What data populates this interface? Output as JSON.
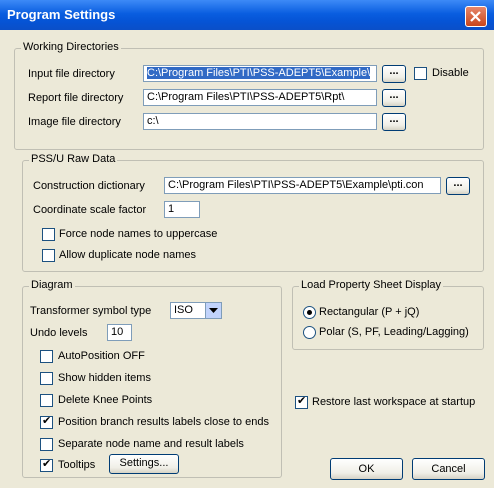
{
  "window": {
    "title": "Program Settings"
  },
  "working_directories": {
    "legend": "Working Directories",
    "input_label": "Input file directory",
    "input_value": "C:\\Program Files\\PTI\\PSS-ADEPT5\\Example\\",
    "report_label": "Report file directory",
    "report_value": "C:\\Program Files\\PTI\\PSS-ADEPT5\\Rpt\\",
    "image_label": "Image file directory",
    "image_value": "c:\\",
    "browse_label": "...",
    "disable_label": "Disable",
    "disable_checked": false
  },
  "pss_raw": {
    "legend": "PSS/U Raw Data",
    "construction_label": "Construction dictionary",
    "construction_value": "C:\\Program Files\\PTI\\PSS-ADEPT5\\Example\\pti.con",
    "scale_label": "Coordinate scale factor",
    "scale_value": "1",
    "force_upper_label": "Force node names to uppercase",
    "allow_dup_label": "Allow duplicate node names"
  },
  "diagram": {
    "legend": "Diagram",
    "transformer_label": "Transformer symbol type",
    "transformer_value": "ISO",
    "undo_label": "Undo levels",
    "undo_value": "10",
    "autoposition_label": "AutoPosition OFF",
    "show_hidden_label": "Show hidden items",
    "delete_knee_label": "Delete Knee Points",
    "position_branch_label": "Position branch results labels close to ends",
    "separate_label": "Separate node name and result labels",
    "tooltips_label": "Tooltips",
    "settings_label": "Settings..."
  },
  "load_property": {
    "legend": "Load Property Sheet Display",
    "rect_label": "Rectangular (P + jQ)",
    "polar_label": "Polar (S, PF, Leading/Lagging)",
    "selected": "rectangular"
  },
  "restore_label": "Restore last workspace at startup",
  "buttons": {
    "ok": "OK",
    "cancel": "Cancel"
  }
}
